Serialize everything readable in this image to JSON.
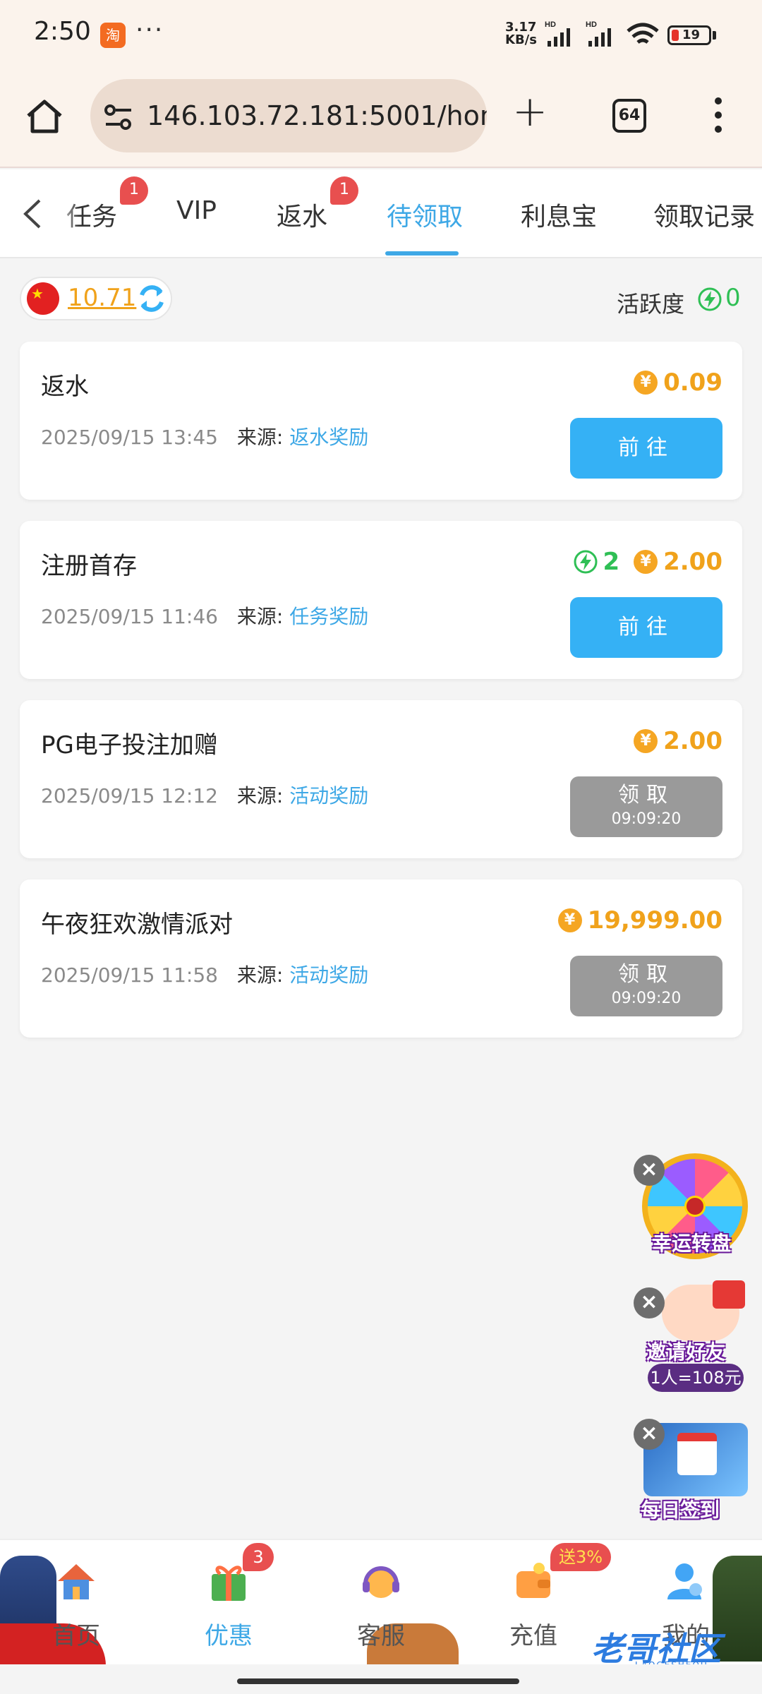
{
  "status_bar": {
    "time": "2:50",
    "app_icon_char": "淘",
    "more": "···",
    "speed_line1": "3.17",
    "speed_line2": "KB/s",
    "battery": "19",
    "battery_level_percent": 19
  },
  "browser": {
    "url": "146.103.72.181:5001/hom",
    "tab_count": "64"
  },
  "tabs": [
    {
      "label": "任务",
      "badge": "1"
    },
    {
      "label": "VIP"
    },
    {
      "label": "返水",
      "badge": "1"
    },
    {
      "label": "待领取",
      "active": true
    },
    {
      "label": "利息宝"
    },
    {
      "label": "领取记录"
    }
  ],
  "balance": {
    "amount": "10.71",
    "activity_label": "活跃度",
    "activity_value": "0"
  },
  "source_label": "来源:",
  "rewards": [
    {
      "title": "返水",
      "date": "2025/09/15 13:45",
      "source": "返水奖励",
      "amount": "0.09",
      "button": "前往",
      "button_style": "blue"
    },
    {
      "title": "注册首存",
      "date": "2025/09/15 11:46",
      "source": "任务奖励",
      "activity": "2",
      "amount": "2.00",
      "button": "前往",
      "button_style": "blue"
    },
    {
      "title": "PG电子投注加赠",
      "date": "2025/09/15 12:12",
      "source": "活动奖励",
      "amount": "2.00",
      "button": "领取",
      "button_style": "gray",
      "timer": "09:09:20"
    },
    {
      "title": "午夜狂欢激情派对",
      "date": "2025/09/15 11:58",
      "source": "活动奖励",
      "amount": "19,999.00",
      "button": "领取",
      "button_style": "gray",
      "timer": "09:09:20"
    }
  ],
  "floating": {
    "wheel_label": "幸运转盘",
    "invite_label": "邀请好友",
    "invite_sub": "1人=108元",
    "signin_label": "每日签到"
  },
  "bottom_nav": [
    {
      "label": "首页"
    },
    {
      "label": "优惠",
      "badge": "3",
      "active": true
    },
    {
      "label": "客服"
    },
    {
      "label": "充值",
      "promo": "送3%"
    },
    {
      "label": "我的"
    }
  ],
  "watermark": {
    "text": "老哥社区",
    "sub": "LAOGESHEQU"
  },
  "colors": {
    "accent": "#3ea8e6",
    "coin": "#f0a21b",
    "activity": "#2fbf55",
    "badge": "#e84f4f",
    "button_blue": "#35b1f5",
    "button_gray": "#9a9a9a"
  }
}
